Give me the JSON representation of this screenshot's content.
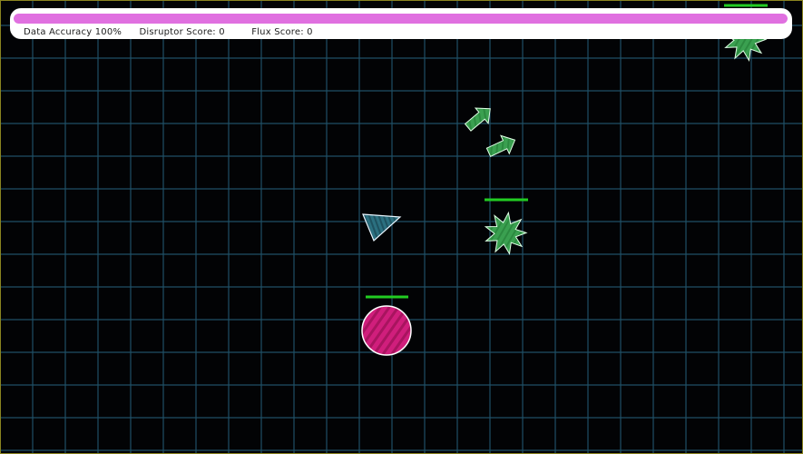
{
  "hud": {
    "accuracy_label": "Data Accuracy",
    "accuracy_value": "100%",
    "accuracy_fraction": 1.0,
    "disruptor_label": "Disruptor Score:",
    "disruptor_value": "0",
    "flux_label": "Flux Score:",
    "flux_value": "0"
  },
  "colors": {
    "background": "#020305",
    "grid": "#1f4f66",
    "accuracy_bar": "#e070e0",
    "health_bar": "#22cc22",
    "enemy": "#3aa050",
    "player": "#2b7080",
    "orb": "#d01e7c"
  },
  "entities": {
    "player": {
      "icon": "triangle-ship-icon"
    },
    "orb": {
      "icon": "pink-orb-icon",
      "health": 1.0
    },
    "enemy_star_center": {
      "icon": "green-star-enemy-icon",
      "health": 1.0
    },
    "enemy_star_corner": {
      "icon": "green-star-enemy-icon",
      "health": 1.0
    },
    "arrow_a": {
      "icon": "green-arrow-icon"
    },
    "arrow_b": {
      "icon": "green-arrow-icon"
    }
  }
}
